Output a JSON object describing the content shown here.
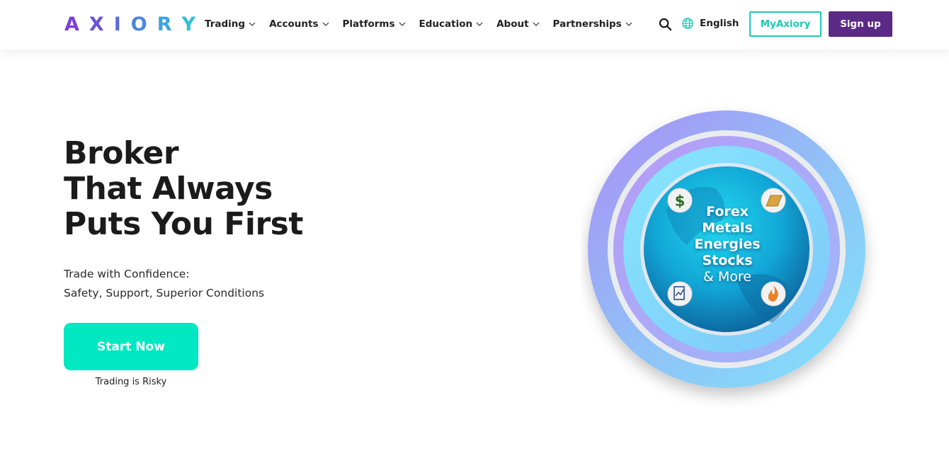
{
  "brand": {
    "logo_letters": [
      "A",
      "X",
      "I",
      "O",
      "R",
      "Y"
    ],
    "logo_colors": [
      "#7b3fd6",
      "#6a52d9",
      "#5a6bdb",
      "#4a86dd",
      "#3ba3df",
      "#2fc1d8"
    ]
  },
  "nav": {
    "items": [
      {
        "label": "Trading"
      },
      {
        "label": "Accounts"
      },
      {
        "label": "Platforms"
      },
      {
        "label": "Education"
      },
      {
        "label": "About"
      },
      {
        "label": "Partnerships"
      }
    ],
    "language": "English",
    "myaxiory_label": "MyAxiory",
    "signup_label": "Sign up",
    "icons": {
      "search": "search-icon",
      "language": "globe-icon",
      "dropdown": "chevron-down-icon"
    }
  },
  "hero": {
    "title_lines": [
      "Broker",
      "That Always",
      "Puts You First"
    ],
    "subtitle_lines": [
      "Trade with Confidence:",
      "Safety, Support, Superior Conditions"
    ],
    "cta_label": "Start Now",
    "risk_note": "Trading is Risky"
  },
  "graphic": {
    "markets": [
      "Forex",
      "Metals",
      "Energies",
      "Stocks"
    ],
    "more": "& More",
    "icons": [
      "dollar-icon",
      "gold-bar-icon",
      "stock-chart-icon",
      "flame-icon"
    ]
  },
  "colors": {
    "accent": "#00e8c2",
    "outline": "#1ec9b7",
    "brand_purple": "#5b2a86"
  }
}
